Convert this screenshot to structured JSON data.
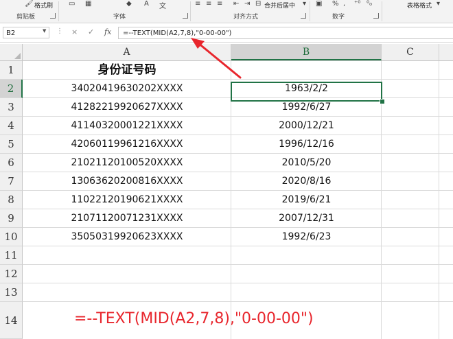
{
  "ribbon": {
    "format_painter": "格式刷",
    "font_text": "字体",
    "merge_center": "合并后居中",
    "table_style": "表格格式",
    "groups": {
      "clipboard": "剪贴板",
      "font": "字体",
      "alignment": "对齐方式",
      "number": "数字"
    }
  },
  "formula_bar": {
    "name_box": "B2",
    "cancel_symbol": "×",
    "enter_symbol": "✓",
    "fx_symbol": "fx",
    "formula": "=--TEXT(MID(A2,7,8),\"0-00-00\")"
  },
  "columns": [
    "A",
    "B",
    "C"
  ],
  "rows": [
    "1",
    "2",
    "3",
    "4",
    "5",
    "6",
    "7",
    "8",
    "9",
    "10",
    "11",
    "12",
    "13",
    "14"
  ],
  "sheet": {
    "header_a1": "身份证号码",
    "data": [
      {
        "id": "34020419630202XXXX",
        "date": "1963/2/2"
      },
      {
        "id": "41282219920627XXXX",
        "date": "1992/6/27"
      },
      {
        "id": "41140320001221XXXX",
        "date": "2000/12/21"
      },
      {
        "id": "42060119961216XXXX",
        "date": "1996/12/16"
      },
      {
        "id": "21021120100520XXXX",
        "date": "2010/5/20"
      },
      {
        "id": "13063620200816XXXX",
        "date": "2020/8/16"
      },
      {
        "id": "11022120190621XXXX",
        "date": "2019/6/21"
      },
      {
        "id": "21071120071231XXXX",
        "date": "2007/12/31"
      },
      {
        "id": "35050319920623XXXX",
        "date": "1992/6/23"
      }
    ],
    "annotation_formula": "=--TEXT(MID(A2,7,8),\"0-00-00\")"
  },
  "colors": {
    "selection_green": "#217346",
    "annotation_red": "#e8262d"
  }
}
